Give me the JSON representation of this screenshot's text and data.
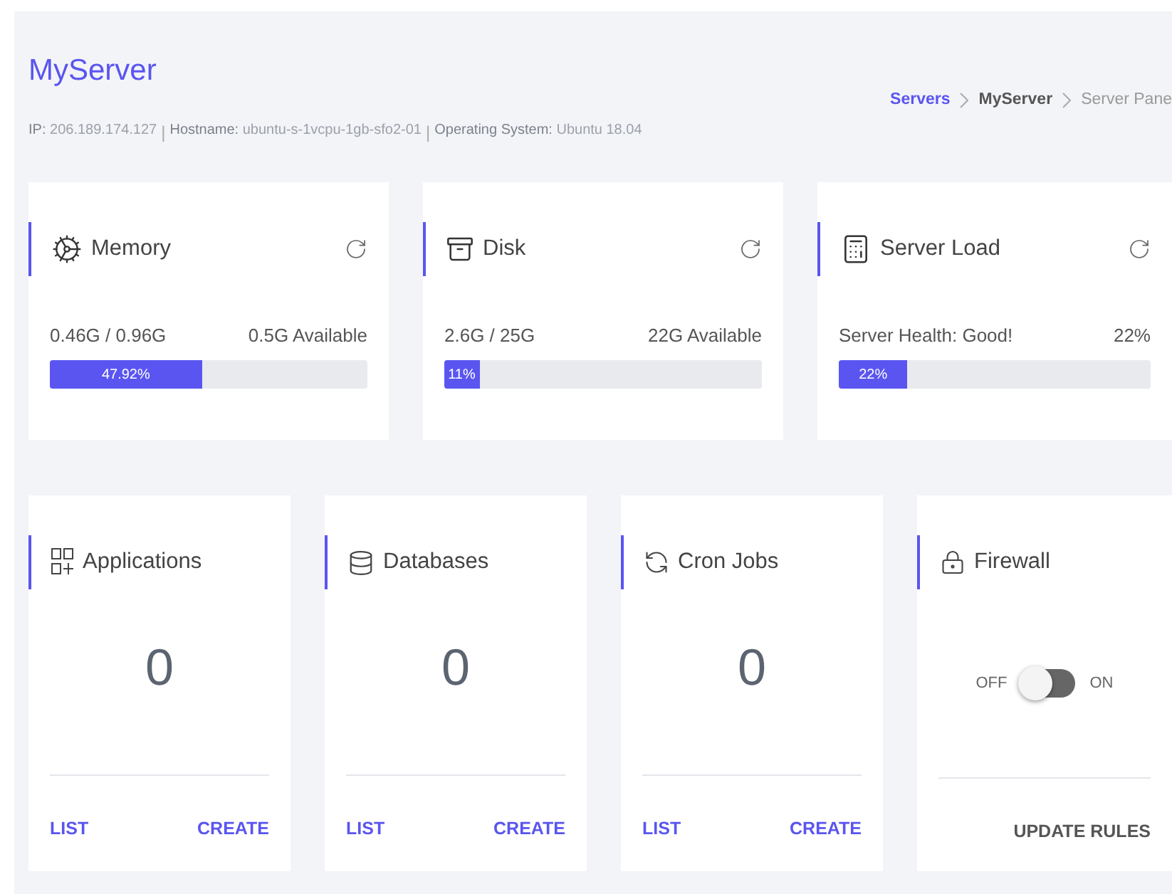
{
  "header": {
    "title": "MyServer",
    "meta_separator": "|",
    "meta": [
      {
        "label": "IP:",
        "value": "206.189.174.127"
      },
      {
        "label": "Hostname:",
        "value": "ubuntu-s-1vcpu-1gb-sfo2-01"
      },
      {
        "label": "Operating System:",
        "value": "Ubuntu 18.04"
      }
    ],
    "breadcrumb": [
      {
        "label": "Servers",
        "kind": "link"
      },
      {
        "label": "MyServer",
        "kind": "current"
      },
      {
        "label": "Server Pane",
        "kind": "plain"
      }
    ]
  },
  "stat_cards": [
    {
      "title": "Memory",
      "used": "0.46G / 0.96G",
      "available": "0.5G Available",
      "level": 0.4792,
      "bar_label": "47.92%"
    },
    {
      "title": "Disk",
      "used": "2.6G / 25G",
      "available": "22G Available",
      "level": 0.11,
      "bar_label": "11%"
    },
    {
      "title": "Server Load",
      "used": "Server Health: Good!",
      "available": "22%",
      "level": 0.22,
      "bar_label": "22%"
    }
  ],
  "count_cards": [
    {
      "title": "Applications",
      "kind": "counter",
      "count": "0",
      "actions": [
        "LIST",
        "CREATE"
      ]
    },
    {
      "title": "Databases",
      "kind": "counter",
      "count": "0",
      "actions": [
        "LIST",
        "CREATE"
      ]
    },
    {
      "title": "Cron Jobs",
      "kind": "counter",
      "count": "0",
      "actions": [
        "LIST",
        "CREATE"
      ]
    },
    {
      "title": "Firewall",
      "kind": "toggle",
      "off_label": "OFF",
      "on_label": "ON",
      "on": false,
      "actions": [
        "UPDATE RULES"
      ]
    }
  ]
}
